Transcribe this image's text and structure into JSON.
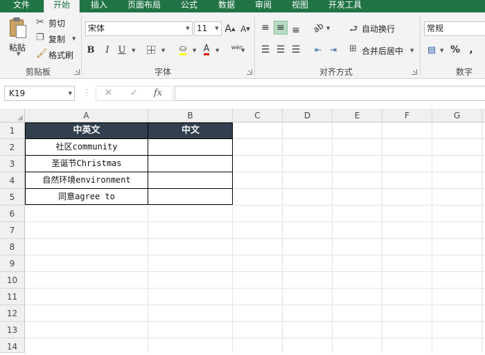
{
  "ribbon_tabs": [
    {
      "label": "文件"
    },
    {
      "label": "开始"
    },
    {
      "label": "插入"
    },
    {
      "label": "页面布局"
    },
    {
      "label": "公式"
    },
    {
      "label": "数据"
    },
    {
      "label": "审阅"
    },
    {
      "label": "视图"
    },
    {
      "label": "开发工具"
    }
  ],
  "active_tab": "开始",
  "clipboard": {
    "paste_label": "粘贴",
    "cut_label": "剪切",
    "copy_label": "复制",
    "format_painter_label": "格式刷",
    "group_label": "剪贴板"
  },
  "font": {
    "family": "宋体",
    "size": "11",
    "grow_icon": "A",
    "shrink_icon": "A",
    "bold": "B",
    "italic": "I",
    "underline": "U",
    "font_color_icon": "A",
    "phonetic_icon": "wén",
    "group_label": "字体"
  },
  "alignment": {
    "wrap_text_label": "自动换行",
    "merge_center_label": "合并后居中",
    "group_label": "对齐方式"
  },
  "number": {
    "format": "常规",
    "percent_icon": "%",
    "comma_icon": ",",
    "group_label": "数字"
  },
  "formula_bar": {
    "name_box": "K19",
    "cancel_icon": "✕",
    "enter_icon": "✓",
    "fx_label": "fx",
    "content": ""
  },
  "grid": {
    "columns": [
      "A",
      "B",
      "C",
      "D",
      "E",
      "F",
      "G"
    ],
    "rows": [
      "1",
      "2",
      "3",
      "4",
      "5",
      "6",
      "7",
      "8",
      "9",
      "10",
      "11",
      "12",
      "13",
      "14"
    ],
    "table": {
      "headers": [
        "中英文",
        "中文"
      ],
      "rows": [
        [
          "社区community",
          ""
        ],
        [
          "圣诞节Christmas",
          ""
        ],
        [
          "自然环境environment",
          ""
        ],
        [
          "同意agree to",
          ""
        ]
      ]
    }
  },
  "colors": {
    "accent": "#217346",
    "header_fill": "#323f4f",
    "header_text": "#ffffff"
  }
}
